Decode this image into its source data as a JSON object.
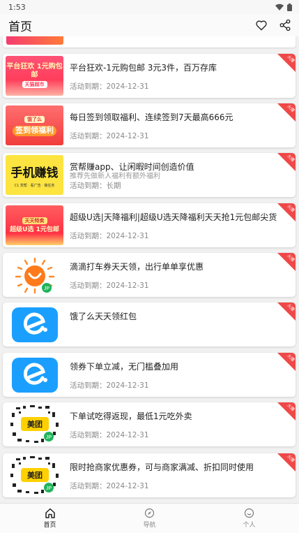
{
  "status": {
    "time": "1:53"
  },
  "header": {
    "title": "首页"
  },
  "cards": [
    {
      "thumb_label": "平台狂欢 1元购包邮",
      "thumb_tag": "天猫超市",
      "title": "平台狂欢-1元购包邮 3元3件，百万存库",
      "expiry": "活动到期：2024-12-31",
      "corner": "火爆"
    },
    {
      "thumb_label": "签到领福利",
      "thumb_tag": "饿了么",
      "title": "每日签到领取福利、连续签到7天最高666元",
      "expiry": "活动到期：2024-12-31",
      "corner": "火爆"
    },
    {
      "thumb_label": "手机赚钱",
      "thumb_tag": "C1 赏帮 · 看广告 · 做任务",
      "title": "赏帮赚app、让闲暇时间创造价值",
      "subtitle": "推荐先做新人福利有额外福利",
      "expiry": "活动到期：长期",
      "corner": "火爆"
    },
    {
      "thumb_label": "超级U选 1元包邮",
      "thumb_tag": "天天特卖",
      "title": "超级U选|天降福利|超级U选天降福利天天抢1元包邮尖货",
      "expiry": "活动到期：2024-12-31",
      "corner": "火爆"
    },
    {
      "title": "滴滴打车券天天领，出行单单享优惠",
      "expiry": "活动到期：2024-12-31",
      "corner": "火爆"
    },
    {
      "title": "饿了么天天领红包",
      "expiry": "",
      "corner": "火爆"
    },
    {
      "title": "领券下单立减，无门槛叠加用",
      "expiry": "活动到期：2024-12-31",
      "corner": "火爆"
    },
    {
      "thumb_label": "美团",
      "title": "下单试吃得返现，最低1元吃外卖",
      "expiry": "活动到期：2024-12-31",
      "corner": "火爆"
    },
    {
      "thumb_label": "美团",
      "title": "限时抢商家优惠券，可与商家满减、折扣同时使用",
      "expiry": "活动到期：2024-12-31",
      "corner": "火爆"
    }
  ],
  "nav": [
    {
      "label": "首页"
    },
    {
      "label": "导航"
    },
    {
      "label": "个人"
    }
  ]
}
